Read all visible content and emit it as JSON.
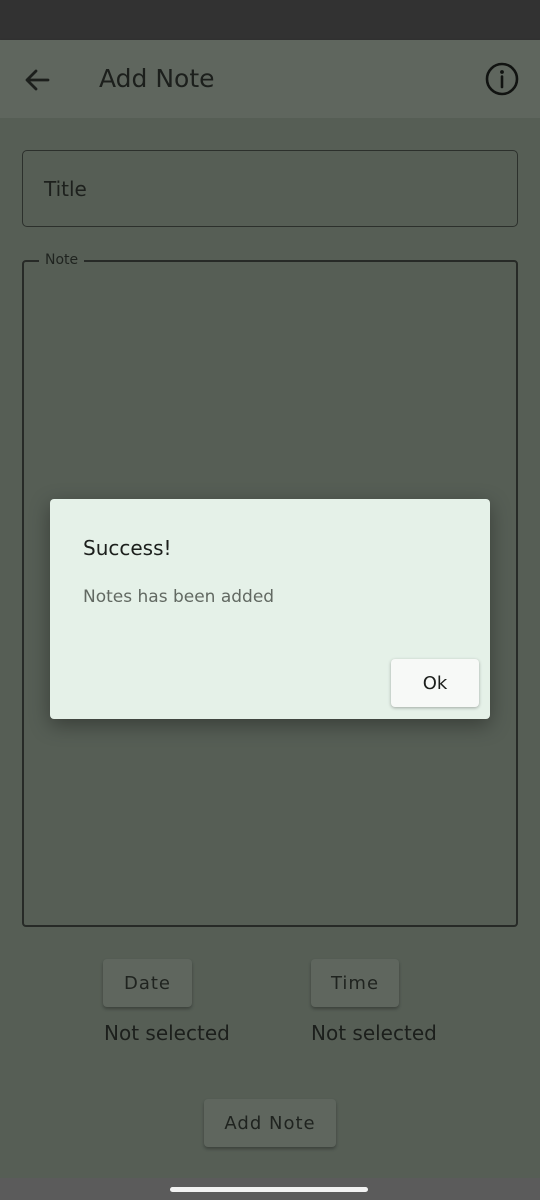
{
  "app_bar": {
    "title": "Add Note",
    "back_icon": "arrow-back-icon",
    "info_icon": "info-icon"
  },
  "form": {
    "title_placeholder": "Title",
    "note_label": "Note",
    "date_button": "Date",
    "time_button": "Time",
    "date_value": "Not selected",
    "time_value": "Not selected",
    "submit_button": "Add Note"
  },
  "dialog": {
    "title": "Success!",
    "message": "Notes has been added",
    "ok_button": "Ok"
  },
  "colors": {
    "scrim_background": "#565e55",
    "dialog_background": "#e5f1e8",
    "status_bar": "#323232"
  }
}
